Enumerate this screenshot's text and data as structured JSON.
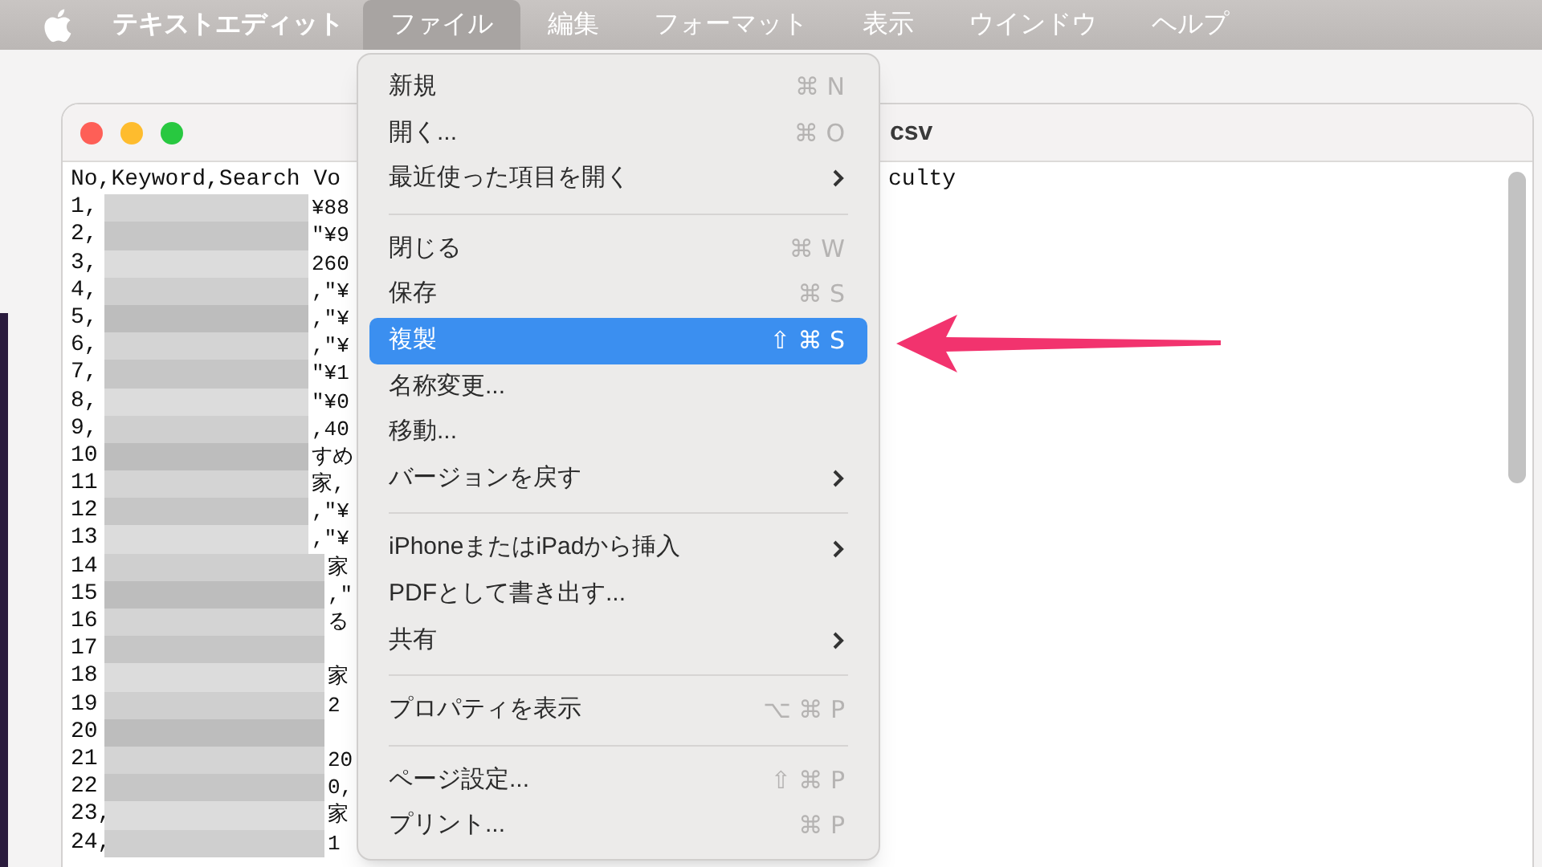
{
  "menu_bar": {
    "app_name": "テキストエディット",
    "menus": [
      {
        "label": "ファイル",
        "selected": true
      },
      {
        "label": "編集",
        "selected": false
      },
      {
        "label": "フォーマット",
        "selected": false
      },
      {
        "label": "表示",
        "selected": false
      },
      {
        "label": "ウインドウ",
        "selected": false
      },
      {
        "label": "ヘルプ",
        "selected": false
      }
    ]
  },
  "window": {
    "title": "csv",
    "header_left": "No,Keyword,Search Vo",
    "header_right": "culty",
    "rows": [
      {
        "no": "1,",
        "tail": "¥88"
      },
      {
        "no": "2,",
        "tail": "\"¥9"
      },
      {
        "no": "3,",
        "tail": "260"
      },
      {
        "no": "4,",
        "tail": ",\"¥"
      },
      {
        "no": "5,",
        "tail": ",\"¥"
      },
      {
        "no": "6,",
        "tail": ",\"¥"
      },
      {
        "no": "7,",
        "tail": "\"¥1"
      },
      {
        "no": "8,",
        "tail": "\"¥0"
      },
      {
        "no": "9,",
        "tail": ",40"
      },
      {
        "no": "10",
        "tail": "すめ"
      },
      {
        "no": "11",
        "tail": "家,"
      },
      {
        "no": "12",
        "tail": ",\"¥"
      },
      {
        "no": "13",
        "tail": ",\"¥"
      },
      {
        "no": "14",
        "tail": "家"
      },
      {
        "no": "15",
        "tail": ",\""
      },
      {
        "no": "16",
        "tail": "る"
      },
      {
        "no": "17"
      },
      {
        "no": "18",
        "tail": "家"
      },
      {
        "no": "19",
        "tail": "2"
      },
      {
        "no": "20"
      },
      {
        "no": "21",
        "tail": "20"
      },
      {
        "no": "22",
        "tail": "0,"
      },
      {
        "no": "23,",
        "tail": "家"
      },
      {
        "no": "24,",
        "tail": "1"
      }
    ]
  },
  "file_menu": [
    {
      "kind": "item",
      "label": "新規",
      "shortcut": "⌘ N",
      "selected": false
    },
    {
      "kind": "item",
      "label": "開く...",
      "shortcut": "⌘ O",
      "selected": false
    },
    {
      "kind": "submenu",
      "label": "最近使った項目を開く",
      "selected": false
    },
    {
      "kind": "separator"
    },
    {
      "kind": "item",
      "label": "閉じる",
      "shortcut": "⌘ W",
      "selected": false
    },
    {
      "kind": "item",
      "label": "保存",
      "shortcut": "⌘ S",
      "selected": false
    },
    {
      "kind": "item",
      "label": "複製",
      "shortcut": "⇧ ⌘ S",
      "selected": true
    },
    {
      "kind": "item",
      "label": "名称変更...",
      "selected": false
    },
    {
      "kind": "item",
      "label": "移動...",
      "selected": false
    },
    {
      "kind": "submenu",
      "label": "バージョンを戻す",
      "selected": false
    },
    {
      "kind": "separator"
    },
    {
      "kind": "submenu",
      "label": "iPhoneまたはiPadから挿入",
      "selected": false
    },
    {
      "kind": "item",
      "label": "PDFとして書き出す...",
      "selected": false
    },
    {
      "kind": "submenu",
      "label": "共有",
      "selected": false
    },
    {
      "kind": "separator"
    },
    {
      "kind": "item",
      "label": "プロパティを表示",
      "shortcut": "⌥ ⌘ P",
      "selected": false
    },
    {
      "kind": "separator"
    },
    {
      "kind": "item",
      "label": "ページ設定...",
      "shortcut": "⇧ ⌘ P",
      "selected": false
    },
    {
      "kind": "item",
      "label": "プリント...",
      "shortcut": "⌘ P",
      "selected": false
    }
  ]
}
